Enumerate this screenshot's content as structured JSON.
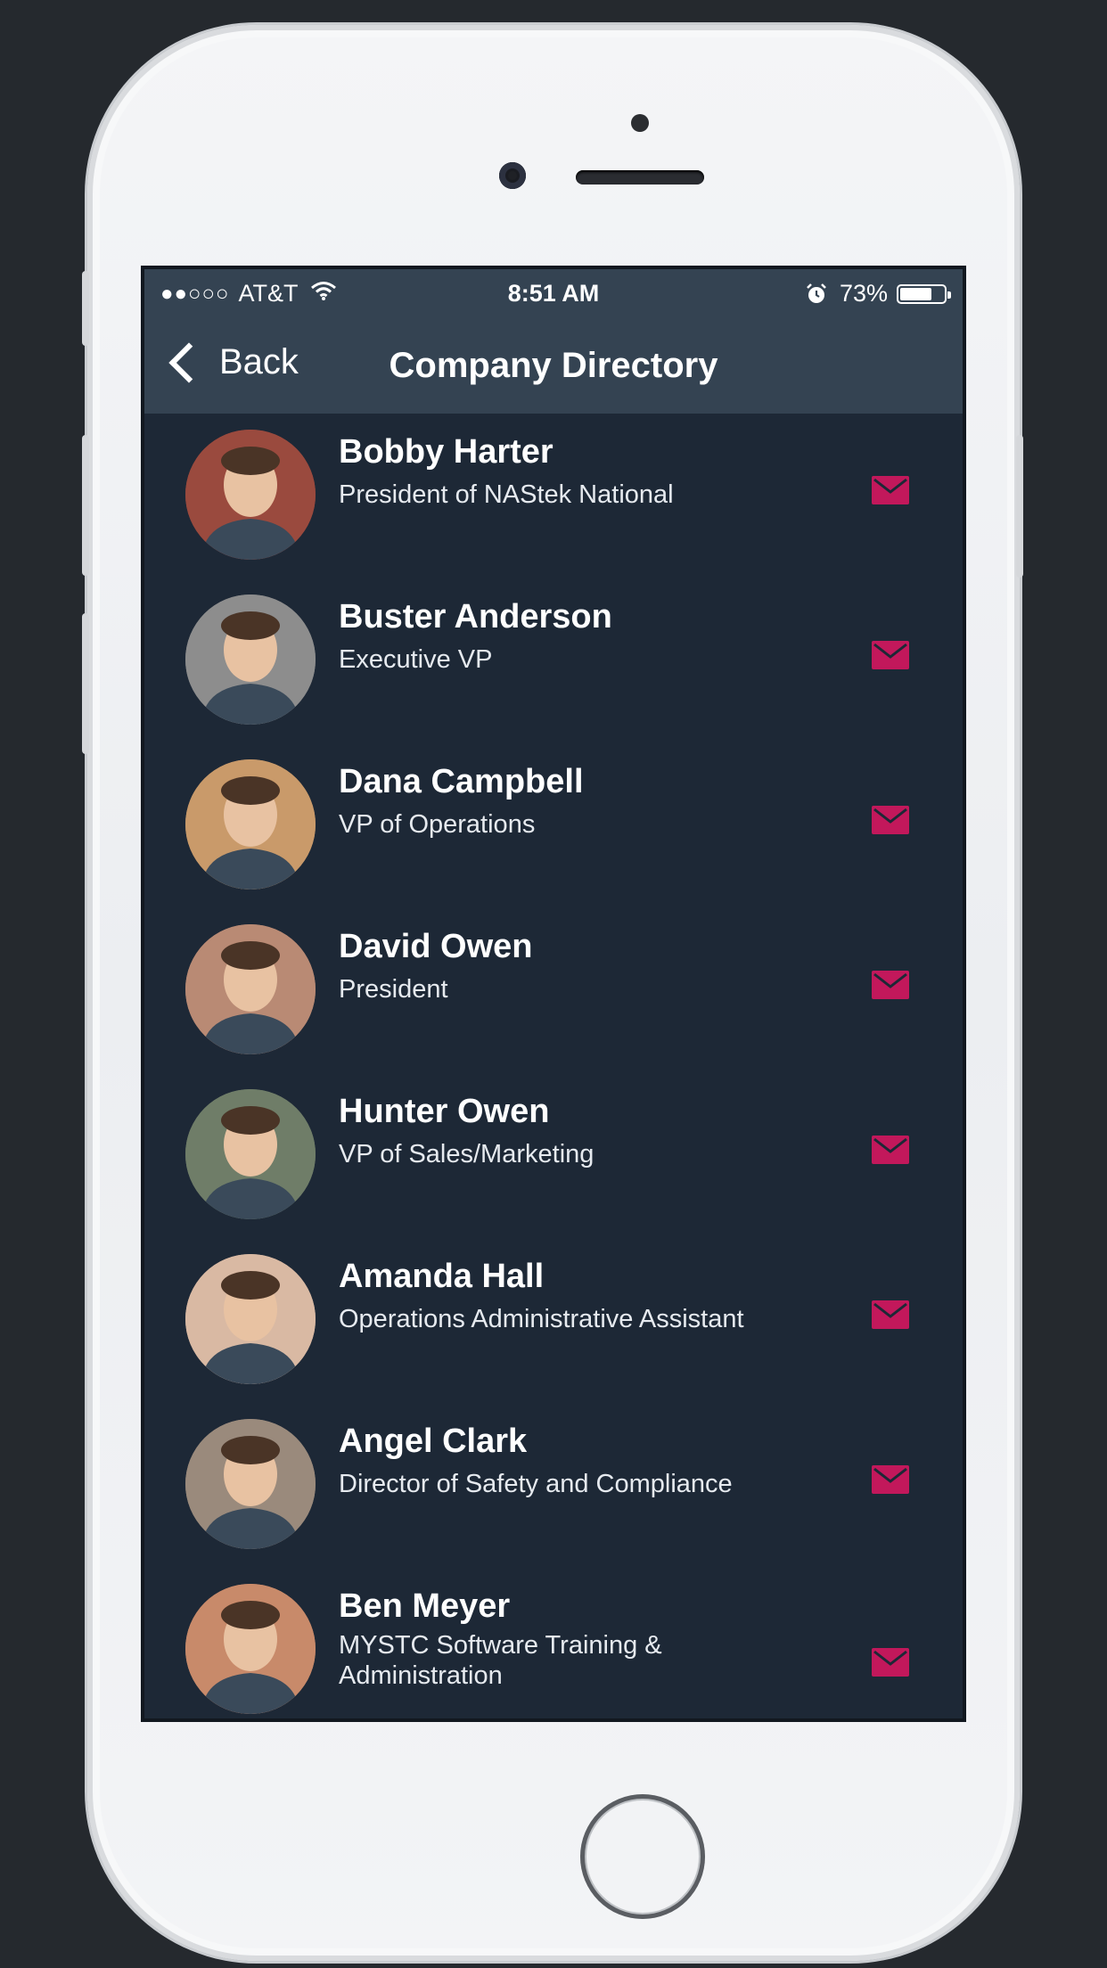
{
  "status_bar": {
    "signal": "●●○○○",
    "carrier": "AT&T",
    "time": "8:51 AM",
    "battery_text": "73%",
    "battery_level": 0.73
  },
  "nav": {
    "back_label": "Back",
    "title": "Company Directory"
  },
  "contacts": [
    {
      "name": "Bobby Harter",
      "title": "President of NAStek National",
      "avatar_bg": "#9a4a3e"
    },
    {
      "name": "Buster Anderson",
      "title": "Executive VP",
      "avatar_bg": "#8d8d8d"
    },
    {
      "name": "Dana Campbell",
      "title": "VP of Operations",
      "avatar_bg": "#c99a6a"
    },
    {
      "name": "David Owen",
      "title": "President",
      "avatar_bg": "#b98a74"
    },
    {
      "name": "Hunter Owen",
      "title": "VP of Sales/Marketing",
      "avatar_bg": "#6f7d68"
    },
    {
      "name": "Amanda Hall",
      "title": "Operations Administrative Assistant",
      "avatar_bg": "#d9b9a3"
    },
    {
      "name": "Angel Clark",
      "title": "Director of Safety and Compliance",
      "avatar_bg": "#9a8a7c"
    },
    {
      "name": "Ben Meyer",
      "title": "MYSTC Software Training & Administration",
      "avatar_bg": "#c88a6a"
    }
  ],
  "colors": {
    "list_bg": "#1d2836",
    "bar_bg": "#344352",
    "mail_accent": "#c2185b"
  },
  "icons": {
    "mail": "envelope-icon",
    "back": "chevron-left-icon",
    "wifi": "wifi-icon",
    "alarm": "alarm-icon",
    "battery": "battery-icon"
  }
}
